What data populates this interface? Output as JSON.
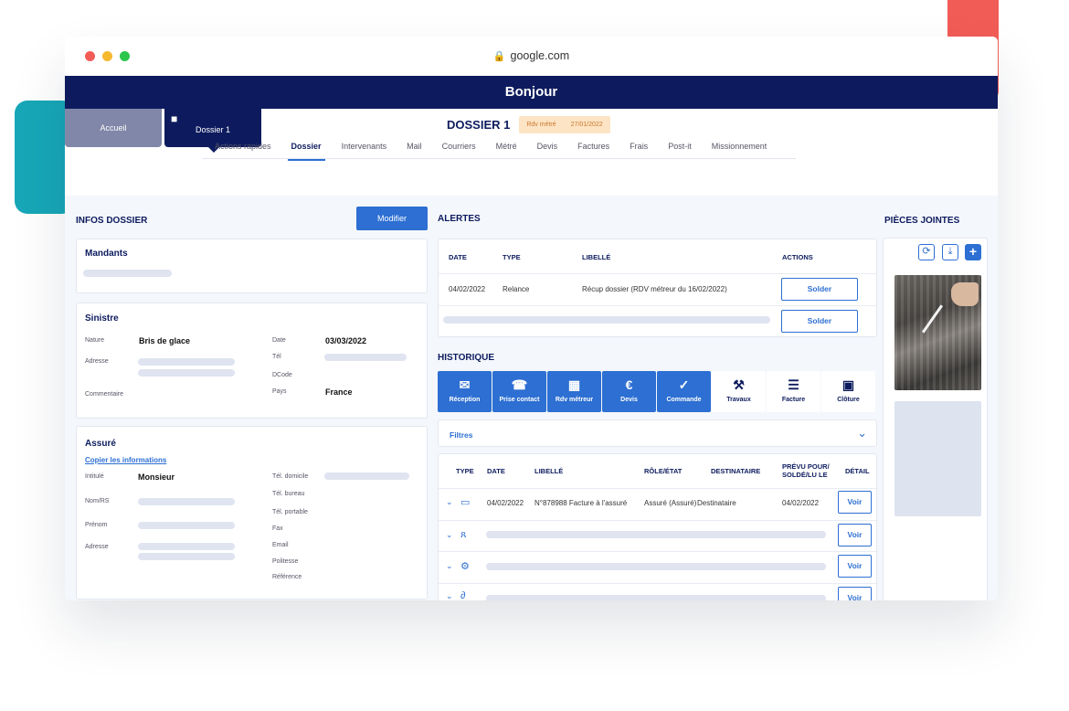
{
  "browser": {
    "url": "google.com",
    "dot_colors": [
      "#f25c57",
      "#f5b92e",
      "#2bc64c"
    ]
  },
  "app": {
    "banner_title": "Bonjour"
  },
  "top_tabs": {
    "home": "Accueil",
    "dossier": "Dossier 1"
  },
  "dossier": {
    "title": "DOSSIER 1",
    "badge_label": "Rdv métré",
    "badge_date": "27/01/2022"
  },
  "nav_tabs": [
    "Actions rapides",
    "Dossier",
    "Intervenants",
    "Mail",
    "Courriers",
    "Métré",
    "Devis",
    "Factures",
    "Frais",
    "Post-it",
    "Missionnement"
  ],
  "nav_active": "Dossier",
  "infos": {
    "title": "INFOS DOSSIER",
    "edit_button": "Modifier",
    "mandants": {
      "title": "Mandants"
    },
    "sinistre": {
      "title": "Sinistre",
      "nature_label": "Nature",
      "nature_value": "Bris de glace",
      "adresse_label": "Adresse",
      "commentaire_label": "Commentaire",
      "date_label": "Date",
      "date_value": "03/03/2022",
      "tel_label": "Tél",
      "dcode_label": "DCode",
      "pays_label": "Pays",
      "pays_value": "France"
    },
    "assure": {
      "title": "Assuré",
      "copy_link": "Copier les informations",
      "intitule_label": "Intitulé",
      "intitule_value": "Monsieur",
      "nom_label": "Nom/RS",
      "prenom_label": "Prénom",
      "adresse_label": "Adresse",
      "tel_dom_label": "Tél. domicile",
      "tel_bur_label": "Tél. bureau",
      "tel_port_label": "Tél. portable",
      "fax_label": "Fax",
      "email_label": "Email",
      "politesse_label": "Politesse",
      "reference_label": "Référence"
    }
  },
  "alertes": {
    "title": "ALERTES",
    "columns": {
      "date": "DATE",
      "type": "TYPE",
      "libelle": "LIBELLÉ",
      "actions": "ACTIONS"
    },
    "row1": {
      "date": "04/02/2022",
      "type": "Relance",
      "libelle": "Récup dossier (RDV métreur du 16/02/2022)",
      "action": "Solder"
    },
    "row2": {
      "action": "Solder"
    }
  },
  "historique": {
    "title": "HISTORIQUE",
    "steps": [
      {
        "label": "Réception",
        "icon": "envelope-icon",
        "glyph": "✉",
        "active": true
      },
      {
        "label": "Prise contact",
        "icon": "phone-icon",
        "glyph": "☎",
        "active": true
      },
      {
        "label": "Rdv métreur",
        "icon": "calendar-icon",
        "glyph": "▦",
        "active": true
      },
      {
        "label": "Devis",
        "icon": "euro-document-icon",
        "glyph": "€",
        "active": true
      },
      {
        "label": "Commande",
        "icon": "check-document-icon",
        "glyph": "✓",
        "active": true
      },
      {
        "label": "Travaux",
        "icon": "tools-icon",
        "glyph": "⚒",
        "active": false
      },
      {
        "label": "Facture",
        "icon": "invoice-icon",
        "glyph": "☰",
        "active": false
      },
      {
        "label": "Clôture",
        "icon": "folder-check-icon",
        "glyph": "▣",
        "active": false
      }
    ],
    "filters_label": "Filtres",
    "columns": {
      "type": "TYPE",
      "date": "DATE",
      "libelle": "LIBELLÉ",
      "role": "RÔLE/ÉTAT",
      "destinataire": "DESTINATAIRE",
      "prevu_1": "PRÉVU POUR/",
      "prevu_2": "SOLDÉ/LU LE",
      "detail": "DÉTAIL"
    },
    "row1": {
      "date": "04/02/2022",
      "libelle": "N°878988 Facture à l'assuré",
      "role": "Assuré (Assuré)",
      "destinataire": "Destinataire",
      "prevu": "04/02/2022",
      "detail": "Voir"
    },
    "detail_label": "Voir"
  },
  "pieces": {
    "title": "PIÈCES JOINTES"
  }
}
